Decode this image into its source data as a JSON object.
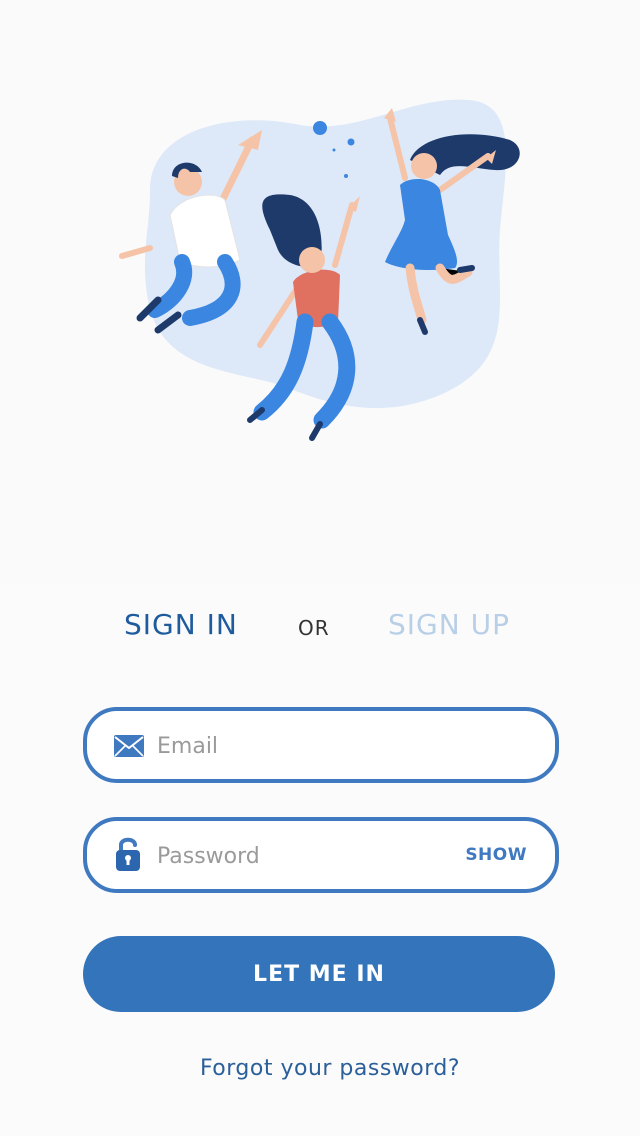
{
  "tabs": {
    "signin_label": "SIGN IN",
    "or_label": "OR",
    "signup_label": "SIGN UP"
  },
  "email": {
    "placeholder": "Email",
    "value": "",
    "icon": "envelope-icon"
  },
  "password": {
    "placeholder": "Password",
    "value": "",
    "icon": "padlock-icon",
    "show_label": "SHOW"
  },
  "submit_label": "LET ME IN",
  "forgot_label": "Forgot your password?",
  "colors": {
    "primary": "#3374ba",
    "title_active": "#1f5c9e",
    "title_inactive": "#b8cfe6",
    "field_border": "#3f79c0",
    "illustration_blob": "#dde9f8"
  }
}
